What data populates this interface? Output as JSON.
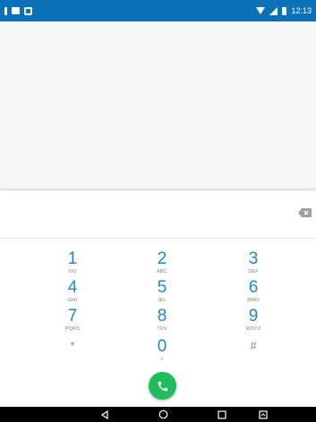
{
  "status_bar": {
    "time": "12:13",
    "icons_left": [
      "notification-icon",
      "message-icon",
      "photo-icon"
    ],
    "icons_right": [
      "wifi-icon",
      "signal-icon",
      "battery-icon"
    ]
  },
  "dialpad": {
    "digits_value": "",
    "keys": [
      {
        "digit": "1",
        "letters": "GO"
      },
      {
        "digit": "2",
        "letters": "ABC"
      },
      {
        "digit": "3",
        "letters": "DEF"
      },
      {
        "digit": "4",
        "letters": "GHI"
      },
      {
        "digit": "5",
        "letters": "JKL"
      },
      {
        "digit": "6",
        "letters": "MNO"
      },
      {
        "digit": "7",
        "letters": "PQRS"
      },
      {
        "digit": "8",
        "letters": "TUV"
      },
      {
        "digit": "9",
        "letters": "WXYZ"
      },
      {
        "digit": "*",
        "letters": ""
      },
      {
        "digit": "0",
        "letters": "+"
      },
      {
        "digit": "#",
        "letters": ""
      }
    ]
  },
  "colors": {
    "status_bar": "#0b71b8",
    "digit": "#1e88c8",
    "call_button": "#1dbd5d",
    "nav_bar": "#000000"
  }
}
